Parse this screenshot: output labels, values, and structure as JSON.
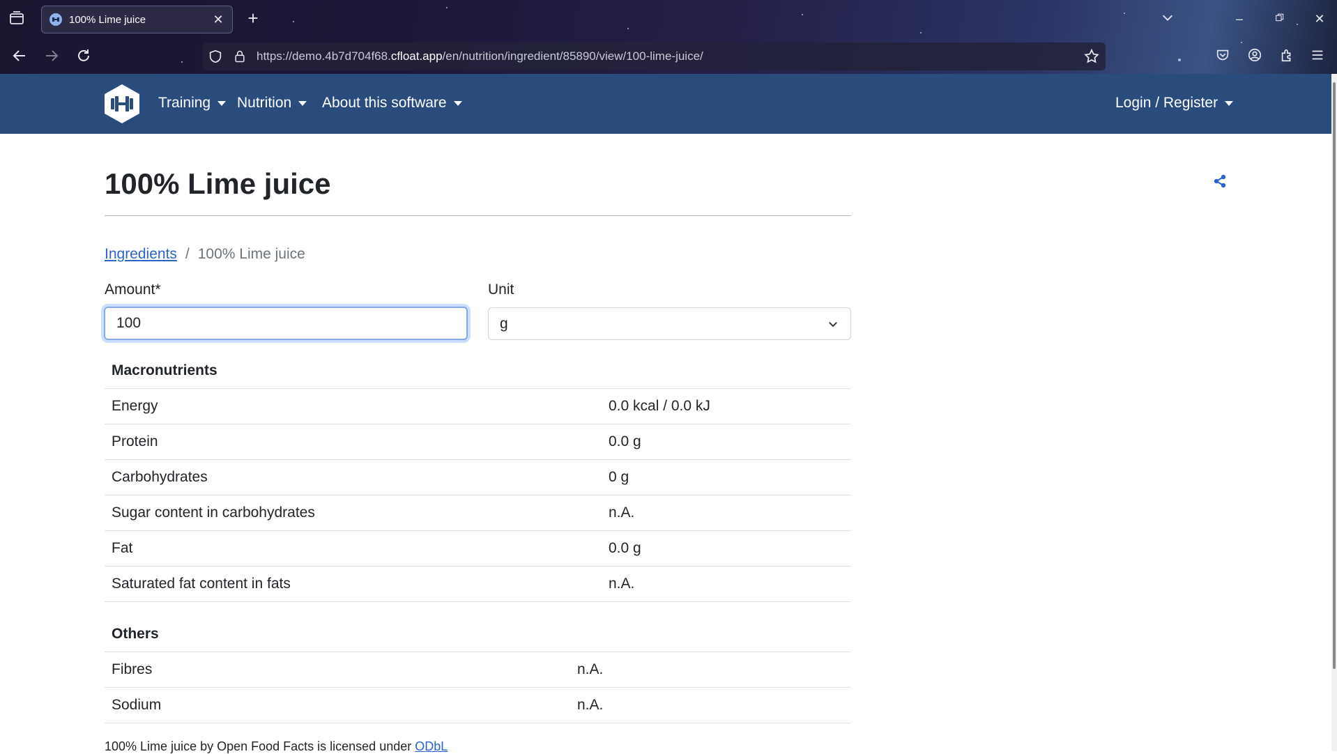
{
  "browser": {
    "tab_title": "100% Lime juice",
    "url_prefix": "https://demo.4b7d704f68.",
    "url_host": "cfloat.app",
    "url_path": "/en/nutrition/ingredient/85890/view/100-lime-juice/"
  },
  "site_nav": {
    "items": [
      {
        "label": "Training"
      },
      {
        "label": "Nutrition"
      },
      {
        "label": "About this software"
      }
    ],
    "login_label": "Login / Register"
  },
  "page": {
    "title": "100% Lime juice",
    "breadcrumb": {
      "link": "Ingredients",
      "separator": "/",
      "current": "100% Lime juice"
    },
    "form": {
      "amount_label": "Amount*",
      "amount_value": "100",
      "unit_label": "Unit",
      "unit_value": "g"
    },
    "macronutrients": {
      "title": "Macronutrients",
      "rows": [
        {
          "name": "Energy",
          "value": "0.0 kcal / 0.0 kJ"
        },
        {
          "name": "Protein",
          "value": "0.0 g"
        },
        {
          "name": "Carbohydrates",
          "value": "0 g"
        },
        {
          "name": "Sugar content in carbohydrates",
          "value": "n.A."
        },
        {
          "name": "Fat",
          "value": "0.0 g"
        },
        {
          "name": "Saturated fat content in fats",
          "value": "n.A."
        }
      ]
    },
    "others": {
      "title": "Others",
      "rows": [
        {
          "name": "Fibres",
          "value": "n.A."
        },
        {
          "name": "Sodium",
          "value": "n.A."
        }
      ]
    },
    "license": {
      "text": "100% Lime juice by Open Food Facts is licensed under ",
      "link": "ODbL"
    }
  },
  "colors": {
    "navbar": "#2a4c7d",
    "link": "#2a64c8"
  }
}
